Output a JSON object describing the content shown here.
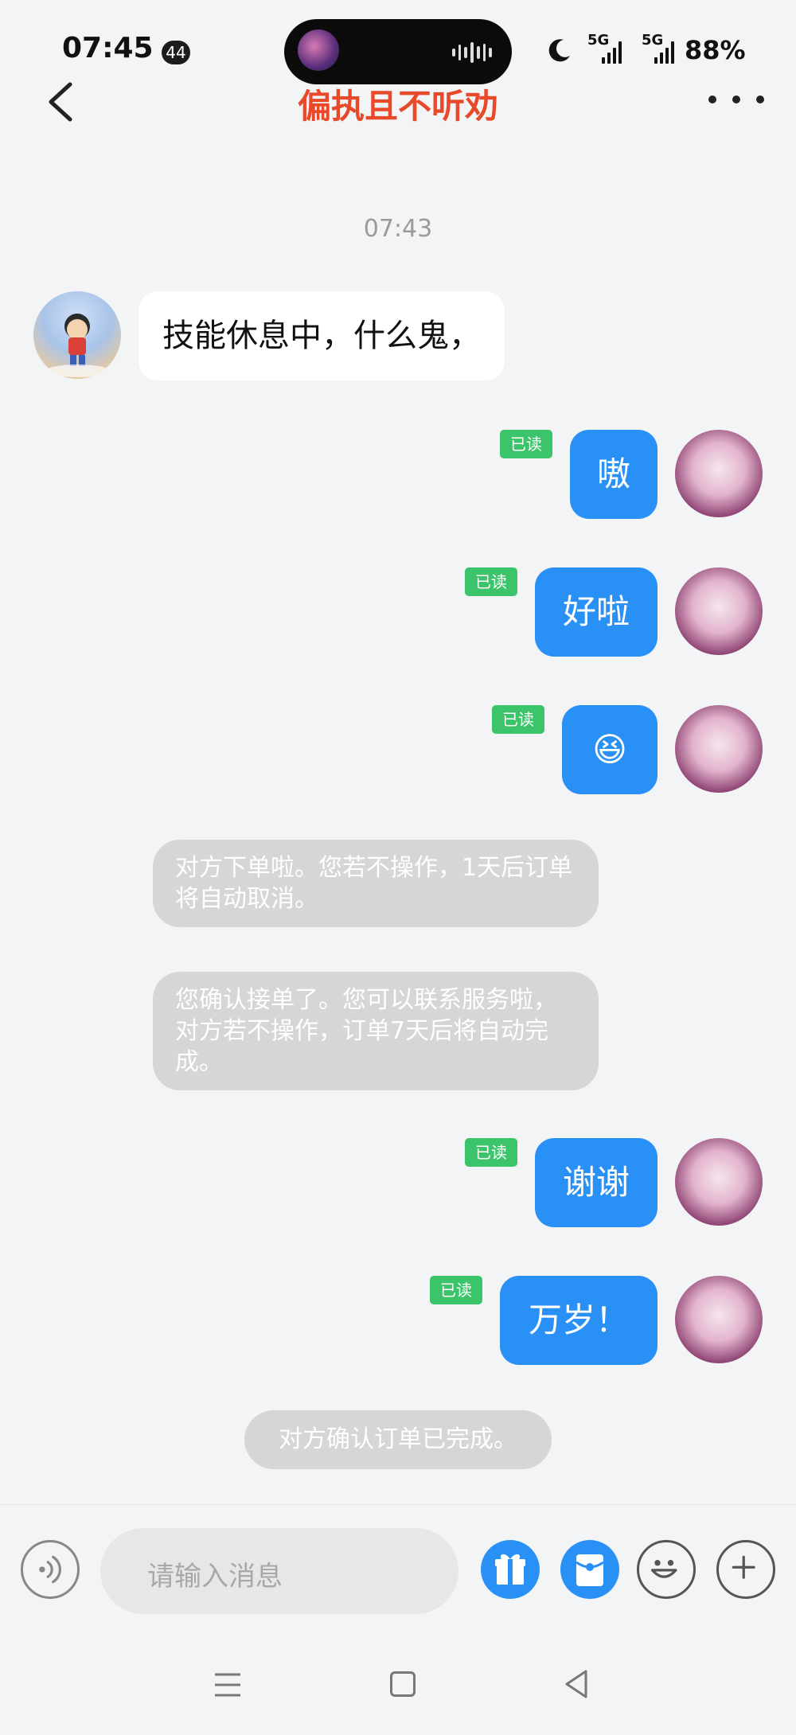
{
  "status_bar": {
    "time": "07:45",
    "notification_count": "44",
    "network_1": "5G",
    "network_2": "5G",
    "battery": "88%"
  },
  "header": {
    "title": "偏执且不听劝",
    "title_color": "#e8492b"
  },
  "chat": {
    "timestamp": "07:43",
    "read_label": "已读",
    "messages": [
      {
        "side": "in",
        "text": "技能休息中，什么鬼，"
      },
      {
        "side": "out",
        "text": "嗷",
        "read": true
      },
      {
        "side": "out",
        "text": "好啦",
        "read": true
      },
      {
        "side": "out",
        "text": "😆",
        "read": true
      },
      {
        "side": "system",
        "text": "对方下单啦。您若不操作，1天后订单将自动取消。"
      },
      {
        "side": "system",
        "text": "您确认接单了。您可以联系服务啦，对方若不操作，订单7天后将自动完成。"
      },
      {
        "side": "out",
        "text": "谢谢",
        "read": true
      },
      {
        "side": "out",
        "text": "万岁！",
        "read": true
      },
      {
        "side": "system",
        "text": "对方确认订单已完成。"
      }
    ]
  },
  "input": {
    "placeholder": "请输入消息"
  },
  "icons": {
    "voice": "voice-icon",
    "gift": "gift-icon",
    "red_packet": "red-packet-icon",
    "emoji": "emoji-icon",
    "plus": "plus-icon"
  },
  "colors": {
    "accent_blue": "#2991f5",
    "read_green": "#3cc46b",
    "system_bubble": "#d5d6d8"
  }
}
